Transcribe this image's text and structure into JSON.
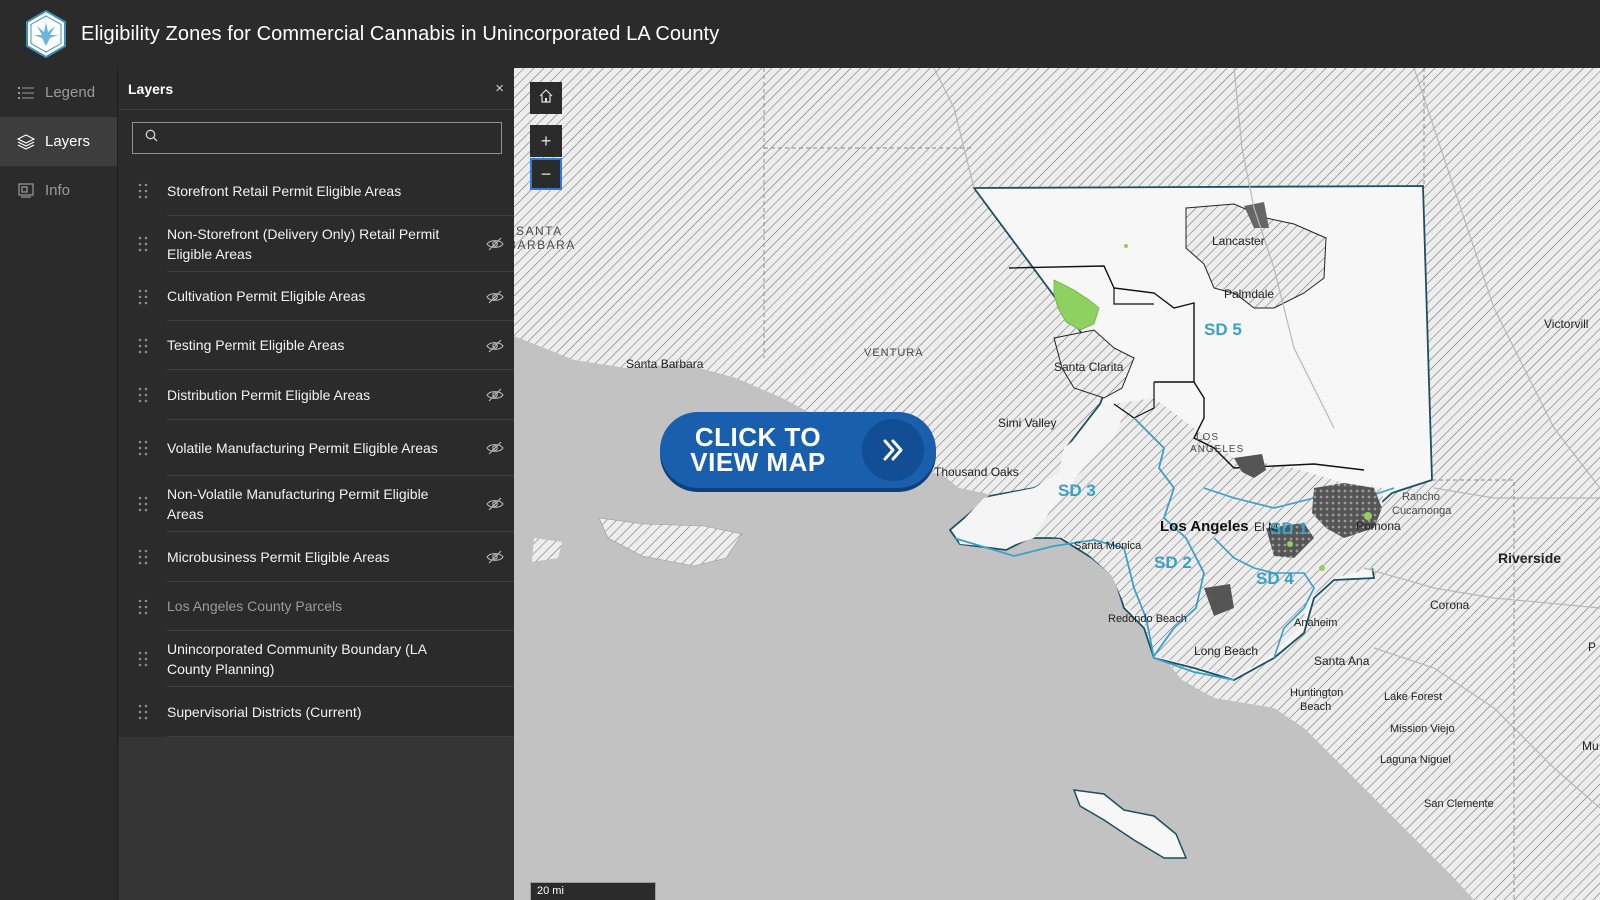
{
  "header": {
    "title": "Eligibility Zones for Commercial Cannabis in Unincorporated LA County"
  },
  "rail": {
    "items": [
      {
        "label": "Legend",
        "icon": "list-icon"
      },
      {
        "label": "Layers",
        "icon": "layers-icon"
      },
      {
        "label": "Info",
        "icon": "info-card-icon"
      }
    ]
  },
  "panel": {
    "title": "Layers",
    "close": "×",
    "search_placeholder": "",
    "layers": [
      {
        "label": "Storefront Retail Permit Eligible Areas",
        "visible": true
      },
      {
        "label": "Non-Storefront (Delivery Only) Retail Permit Eligible Areas",
        "visible": false
      },
      {
        "label": "Cultivation Permit Eligible Areas",
        "visible": false
      },
      {
        "label": "Testing Permit Eligible Areas",
        "visible": false
      },
      {
        "label": "Distribution Permit Eligible Areas",
        "visible": false
      },
      {
        "label": "Volatile Manufacturing Permit Eligible Areas",
        "visible": false
      },
      {
        "label": "Non-Volatile Manufacturing Permit Eligible Areas",
        "visible": false
      },
      {
        "label": "Microbusiness Permit Eligible Areas",
        "visible": false
      },
      {
        "label": "Los Angeles County Parcels",
        "visible": true
      },
      {
        "label": "Unincorporated Community Boundary (LA County Planning)",
        "visible": true
      },
      {
        "label": "Supervisorial Districts (Current)",
        "visible": true
      }
    ]
  },
  "map": {
    "zoom_in": "+",
    "zoom_out": "−",
    "scale": "20 mi",
    "cta_line1": "CLICK TO",
    "cta_line2": "VIEW MAP",
    "labels": {
      "santa_barbara_county": [
        "SANTA",
        "BARBARA"
      ],
      "santa_barbara": "Santa Barbara",
      "ventura": "VENTURA",
      "lancaster": "Lancaster",
      "palmdale": "Palmdale",
      "santa_clarita": "Santa Clarita",
      "simi_valley": "Simi Valley",
      "thousand_oaks": "Thousand Oaks",
      "los_angeles_county": [
        "LOS",
        "ANGELES"
      ],
      "los_angeles": "Los Angeles",
      "santa_monica": "Santa Monica",
      "el_monte": "El M",
      "pomona": "Pomona",
      "rancho": [
        "Rancho",
        "Cucamonga"
      ],
      "riverside": "Riverside",
      "victorville": "Victorvill",
      "corona": "Corona",
      "anaheim": "Anaheim",
      "redondo": "Redondo Beach",
      "long_beach": "Long Beach",
      "santa_ana": "Santa Ana",
      "huntington": [
        "Huntington",
        "Beach"
      ],
      "lake_forest": "Lake Forest",
      "mission_viejo": "Mission Viejo",
      "laguna_niguel": "Laguna Niguel",
      "san_clemente": "San Clemente",
      "p_edge": "P",
      "mu_edge": "Mu",
      "sd1": "SD 1",
      "sd2": "SD 2",
      "sd3": "SD 3",
      "sd4": "SD 4",
      "sd5": "SD 5"
    }
  },
  "colors": {
    "header_bg": "#2b2b2b",
    "cta_blue": "#1a5fae",
    "sd_label": "#3aa0c9",
    "eligible_green": "#8fd160",
    "water": "#c4c4c4"
  }
}
